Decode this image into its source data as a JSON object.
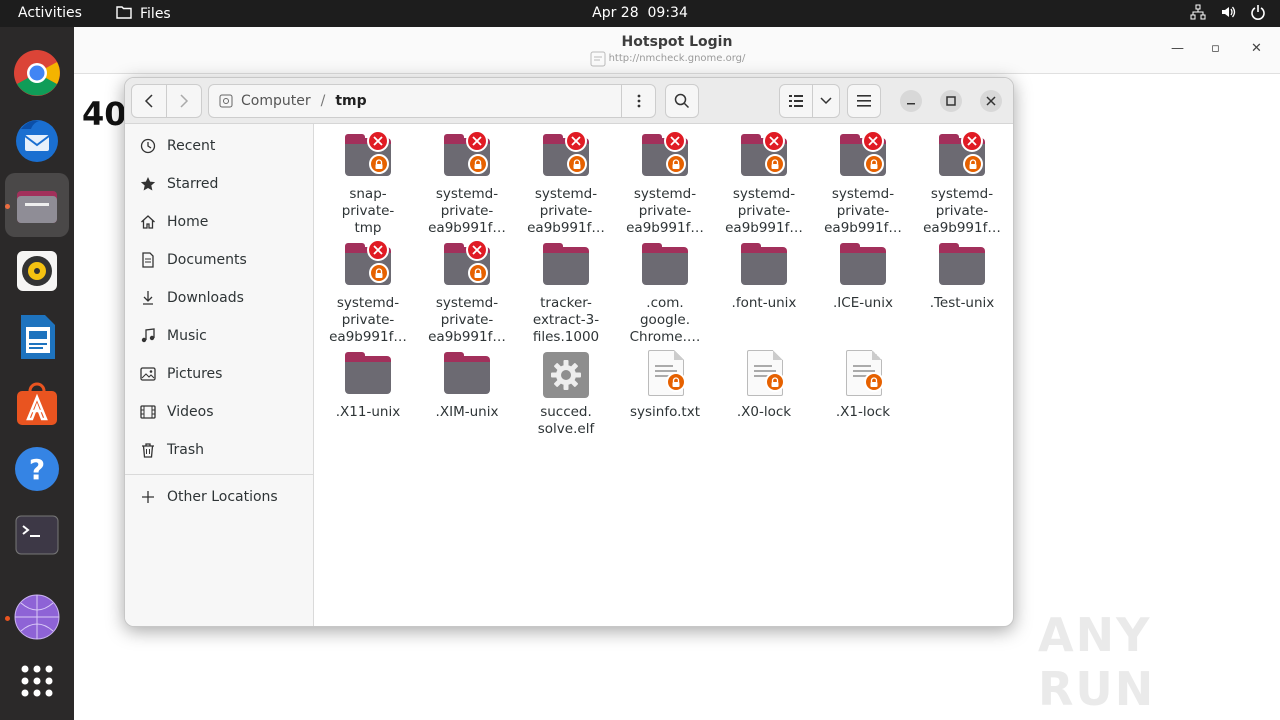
{
  "topbar": {
    "activities": "Activities",
    "app_name": "Files",
    "date": "Apr 28",
    "time": "09:34"
  },
  "dock": {
    "items": [
      "Google Chrome",
      "Thunderbird Mail",
      "Files",
      "Rhythmbox",
      "LibreOffice Writer",
      "Ubuntu Software",
      "Help",
      "Terminal",
      "Network",
      "Show Applications"
    ]
  },
  "browser": {
    "title": "Hotspot Login",
    "url": "http://nmcheck.gnome.org/",
    "partial_heading": "40"
  },
  "files_window": {
    "path_root": "Computer",
    "path_current": "tmp",
    "sidebar": [
      {
        "label": "Recent",
        "icon": "clock-icon"
      },
      {
        "label": "Starred",
        "icon": "star-icon"
      },
      {
        "label": "Home",
        "icon": "home-icon"
      },
      {
        "label": "Documents",
        "icon": "document-icon"
      },
      {
        "label": "Downloads",
        "icon": "download-icon"
      },
      {
        "label": "Music",
        "icon": "music-icon"
      },
      {
        "label": "Pictures",
        "icon": "picture-icon"
      },
      {
        "label": "Videos",
        "icon": "video-icon"
      },
      {
        "label": "Trash",
        "icon": "trash-icon"
      }
    ],
    "other_locations": "Other Locations",
    "files": [
      {
        "line1": "snap-",
        "line2": "private-",
        "line3": "tmp",
        "type": "folder-locked"
      },
      {
        "line1": "systemd-",
        "line2": "private-",
        "line3": "ea9b991f…",
        "type": "folder-locked"
      },
      {
        "line1": "systemd-",
        "line2": "private-",
        "line3": "ea9b991f…",
        "type": "folder-locked"
      },
      {
        "line1": "systemd-",
        "line2": "private-",
        "line3": "ea9b991f…",
        "type": "folder-locked"
      },
      {
        "line1": "systemd-",
        "line2": "private-",
        "line3": "ea9b991f…",
        "type": "folder-locked"
      },
      {
        "line1": "systemd-",
        "line2": "private-",
        "line3": "ea9b991f…",
        "type": "folder-locked"
      },
      {
        "line1": "systemd-",
        "line2": "private-",
        "line3": "ea9b991f…",
        "type": "folder-locked"
      },
      {
        "line1": "systemd-",
        "line2": "private-",
        "line3": "ea9b991f…",
        "type": "folder-locked"
      },
      {
        "line1": "systemd-",
        "line2": "private-",
        "line3": "ea9b991f…",
        "type": "folder-locked"
      },
      {
        "line1": "tracker-",
        "line2": "extract-3-",
        "line3": "files.1000",
        "type": "folder"
      },
      {
        "line1": ".com.",
        "line2": "google.",
        "line3": "Chrome.…",
        "type": "folder"
      },
      {
        "line1": ".font-unix",
        "line2": "",
        "line3": "",
        "type": "folder"
      },
      {
        "line1": ".ICE-unix",
        "line2": "",
        "line3": "",
        "type": "folder"
      },
      {
        "line1": ".Test-unix",
        "line2": "",
        "line3": "",
        "type": "folder"
      },
      {
        "line1": ".X11-unix",
        "line2": "",
        "line3": "",
        "type": "folder"
      },
      {
        "line1": ".XIM-unix",
        "line2": "",
        "line3": "",
        "type": "folder"
      },
      {
        "line1": "succed.",
        "line2": "solve.elf",
        "line3": "",
        "type": "executable"
      },
      {
        "line1": "sysinfo.txt",
        "line2": "",
        "line3": "",
        "type": "text-locked"
      },
      {
        "line1": ".X0-lock",
        "line2": "",
        "line3": "",
        "type": "text-locked"
      },
      {
        "line1": ".X1-lock",
        "line2": "",
        "line3": "",
        "type": "text-locked"
      }
    ]
  },
  "watermark": "ANY RUN",
  "colors": {
    "folder_accent": "#a2305b",
    "folder_body": "#5e5c64",
    "error_emblem": "#e01b24",
    "lock_emblem": "#e66100",
    "dock_bg": "#2b2929",
    "topbar_bg": "#1d1d1d"
  }
}
